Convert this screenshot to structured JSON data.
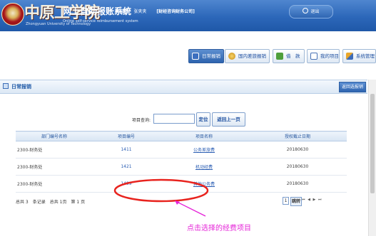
{
  "header": {
    "school_name": "中原工学院",
    "school_name_en": "Zhongyuan University of Technology",
    "system_title": "网上自助报账系统",
    "system_title_en": "Online self-service reimbursement system",
    "welcome_label": "欢迎您:",
    "user_name": "张夹夹",
    "org_name": "[财经咨询财务公司]",
    "logout_label": "退出"
  },
  "nav": {
    "items": [
      {
        "label": "日常报销",
        "icon": "document-icon",
        "active": true
      },
      {
        "label": "国内差旅报销",
        "icon": "coins-icon",
        "active": false
      },
      {
        "label": "借　款",
        "icon": "loan-icon",
        "active": false
      },
      {
        "label": "我的项目",
        "icon": "project-icon",
        "active": false
      },
      {
        "label": "系统管理",
        "icon": "settings-pen-icon",
        "active": false
      }
    ]
  },
  "section": {
    "title": "日常报销",
    "back_button": "返回选报销"
  },
  "search": {
    "label": "项目查询:",
    "placeholder": "",
    "value": "",
    "locate_button": "定位",
    "prev_button": "返回上一页"
  },
  "table": {
    "columns": [
      "部门编号名称",
      "项目编号",
      "项目名称",
      "授权截止日期"
    ],
    "rows": [
      [
        "2300-财务处",
        "1411",
        "公务差旅费",
        "20180630"
      ],
      [
        "2300-财务处",
        "1421",
        "机动经费",
        "20180630"
      ],
      [
        "2300-财务处",
        "1499",
        "其他公务费",
        "20180630"
      ]
    ]
  },
  "pager": {
    "total_records": "总共 3",
    "records_unit": "条记录",
    "total_pages": "总共 1页",
    "current_page": "第 1 页",
    "page_input": "1",
    "go_label": "跳转",
    "arrows": "⏮ ◀ ▶ ⏭"
  },
  "annotation": {
    "text": "点击选择的经费项目",
    "color": "#e524d8"
  },
  "colors": {
    "header_blue": "#2c67b9",
    "accent_blue": "#1d58a6",
    "highlight_red": "#e8231e",
    "annotation_magenta": "#e524d8"
  }
}
